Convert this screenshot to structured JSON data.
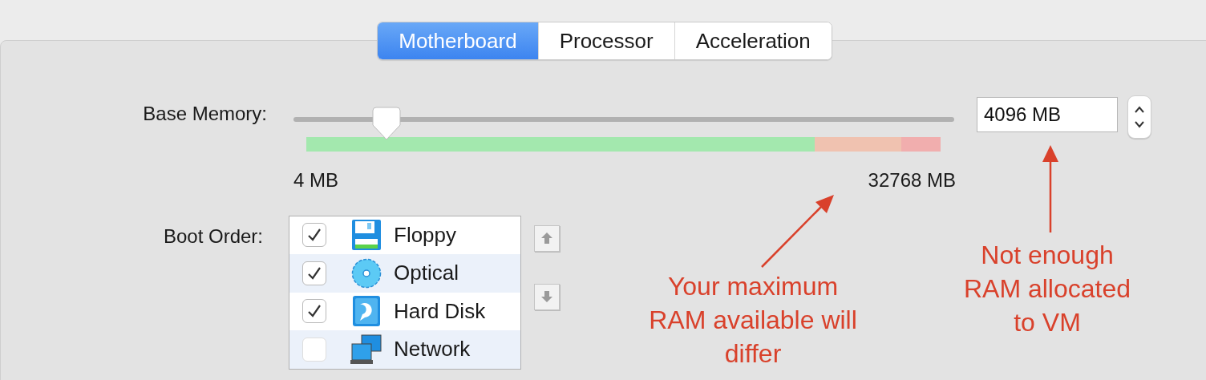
{
  "tabs": [
    {
      "label": "Motherboard",
      "selected": true
    },
    {
      "label": "Processor",
      "selected": false
    },
    {
      "label": "Acceleration",
      "selected": false
    }
  ],
  "base_memory": {
    "label": "Base Memory:",
    "level": 0.141,
    "value": "4096 MB",
    "min_label": "4 MB",
    "max_label": "32768 MB"
  },
  "boot_order": {
    "label": "Boot Order:",
    "items": [
      {
        "label": "Floppy",
        "kind": "floppy",
        "checked": true
      },
      {
        "label": "Optical",
        "kind": "optical",
        "checked": true
      },
      {
        "label": "Hard Disk",
        "kind": "hdd",
        "checked": true
      },
      {
        "label": "Network",
        "kind": "network",
        "checked": false
      }
    ]
  },
  "annotations": [
    {
      "text": "Your maximum\nRAM available will\ndiffer"
    },
    {
      "text": "Not enough\nRAM allocated\nto VM"
    }
  ]
}
